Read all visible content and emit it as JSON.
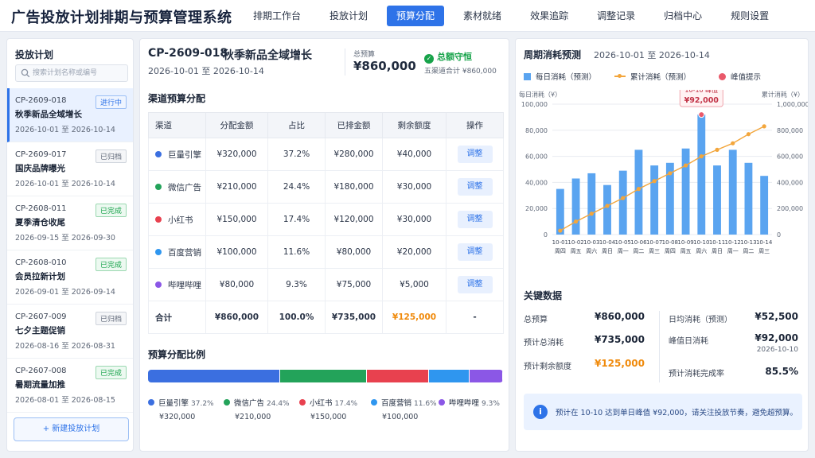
{
  "app": {
    "title": "广告投放计划排期与预算管理系统"
  },
  "nav": [
    {
      "label": "排期工作台",
      "active": false
    },
    {
      "label": "投放计划",
      "active": false
    },
    {
      "label": "预算分配",
      "active": true
    },
    {
      "label": "素材就绪",
      "active": false
    },
    {
      "label": "效果追踪",
      "active": false
    },
    {
      "label": "调整记录",
      "active": false
    },
    {
      "label": "归档中心",
      "active": false
    },
    {
      "label": "规则设置",
      "active": false
    }
  ],
  "sidebar": {
    "title": "投放计划",
    "search_placeholder": "搜索计划名称或编号",
    "new_button": "+ 新建投放计划",
    "plans": [
      {
        "code": "CP-2609-018",
        "name": "秋季新品全域增长",
        "dates": "2026-10-01 至 2026-10-14",
        "status": "进行中",
        "status_type": "run",
        "active": true
      },
      {
        "code": "CP-2609-017",
        "name": "国庆品牌曝光",
        "dates": "2026-10-01 至 2026-10-14",
        "status": "已归档",
        "status_type": "arch",
        "active": false
      },
      {
        "code": "CP-2608-011",
        "name": "夏季清仓收尾",
        "dates": "2026-09-15 至 2026-09-30",
        "status": "已完成",
        "status_type": "done",
        "active": false
      },
      {
        "code": "CP-2608-010",
        "name": "会员拉新计划",
        "dates": "2026-09-01 至 2026-09-14",
        "status": "已完成",
        "status_type": "done",
        "active": false
      },
      {
        "code": "CP-2607-009",
        "name": "七夕主题促销",
        "dates": "2026-08-16 至 2026-08-31",
        "status": "已归档",
        "status_type": "arch",
        "active": false
      },
      {
        "code": "CP-2607-008",
        "name": "暑期流量加推",
        "dates": "2026-08-01 至 2026-08-15",
        "status": "已完成",
        "status_type": "done",
        "active": false
      }
    ]
  },
  "plan": {
    "code": "CP-2609-018",
    "name": "秋季新品全域增长",
    "range": "2026-10-01 至 2026-10-14",
    "budget_label": "总预算",
    "budget_value": "¥860,000",
    "guard_label": "总额守恒",
    "guard_sub": "五渠道合计 ¥860,000"
  },
  "allocation": {
    "title": "渠道预算分配",
    "headers": [
      "渠道",
      "分配金额",
      "占比",
      "已排金额",
      "剩余额度",
      "操作"
    ],
    "adjust_label": "调整",
    "rows": [
      {
        "channel": "巨量引擎",
        "color": "#3b6fe0",
        "amount": "¥320,000",
        "ratio": "37.2%",
        "scheduled": "¥280,000",
        "remaining": "¥40,000"
      },
      {
        "channel": "微信广告",
        "color": "#23a35a",
        "amount": "¥210,000",
        "ratio": "24.4%",
        "scheduled": "¥180,000",
        "remaining": "¥30,000"
      },
      {
        "channel": "小红书",
        "color": "#e8414f",
        "amount": "¥150,000",
        "ratio": "17.4%",
        "scheduled": "¥120,000",
        "remaining": "¥30,000"
      },
      {
        "channel": "百度营销",
        "color": "#2f96ef",
        "amount": "¥100,000",
        "ratio": "11.6%",
        "scheduled": "¥80,000",
        "remaining": "¥20,000"
      },
      {
        "channel": "哔哩哔哩",
        "color": "#8b57e6",
        "amount": "¥80,000",
        "ratio": "9.3%",
        "scheduled": "¥75,000",
        "remaining": "¥5,000"
      }
    ],
    "total": {
      "label": "合计",
      "amount": "¥860,000",
      "ratio": "100.0%",
      "scheduled": "¥735,000",
      "remaining": "¥125,000",
      "op": "-"
    }
  },
  "ratio": {
    "title": "预算分配比例",
    "segments": [
      {
        "name": "巨量引擎",
        "pct": 37.2,
        "pct_label": "37.2%",
        "amount": "¥320,000",
        "color": "#3b6fe0"
      },
      {
        "name": "微信广告",
        "pct": 24.4,
        "pct_label": "24.4%",
        "amount": "¥210,000",
        "color": "#23a35a"
      },
      {
        "name": "小红书",
        "pct": 17.4,
        "pct_label": "17.4%",
        "amount": "¥150,000",
        "color": "#e8414f"
      },
      {
        "name": "百度营销",
        "pct": 11.6,
        "pct_label": "11.6%",
        "amount": "¥100,000",
        "color": "#2f96ef"
      },
      {
        "name": "哔哩哔哩",
        "pct": 9.3,
        "pct_label": "9.3%",
        "amount": "¥80,000",
        "color": "#8b57e6"
      }
    ]
  },
  "forecast": {
    "title": "周期消耗预测",
    "range": "2026-10-01 至 2026-10-14",
    "legend": [
      "每日消耗（预测）",
      "累计消耗（预测）",
      "峰值提示"
    ]
  },
  "chart_data": {
    "type": "bar",
    "title": "周期消耗预测",
    "ylabel": "每日消耗（¥）",
    "y2label": "累计消耗（¥）",
    "ylim": [
      0,
      100000
    ],
    "y2lim": [
      0,
      1000000
    ],
    "yticks": [
      "0",
      "20,000",
      "40,000",
      "60,000",
      "80,000",
      "100,000"
    ],
    "y2ticks": [
      "0",
      "200,000",
      "400,000",
      "600,000",
      "800,000",
      "1,000,000"
    ],
    "categories": [
      "10-01",
      "10-02",
      "10-03",
      "10-04",
      "10-05",
      "10-06",
      "10-07",
      "10-08",
      "10-09",
      "10-10",
      "10-11",
      "10-12",
      "10-13",
      "10-14"
    ],
    "weekdays": [
      "周四",
      "周五",
      "周六",
      "周日",
      "周一",
      "周二",
      "周三",
      "周四",
      "周五",
      "周六",
      "周日",
      "周一",
      "周二",
      "周三"
    ],
    "series": [
      {
        "name": "每日消耗（预测）",
        "type": "bar",
        "color": "#5aa4f0",
        "values": [
          35000,
          43000,
          47000,
          38000,
          49000,
          65000,
          53000,
          55000,
          66000,
          92000,
          53000,
          65000,
          55000,
          45000
        ]
      },
      {
        "name": "累计消耗（预测）",
        "type": "line",
        "color": "#f3a63c",
        "values": [
          30000,
          100000,
          160000,
          220000,
          280000,
          350000,
          410000,
          470000,
          530000,
          600000,
          650000,
          700000,
          770000,
          830000
        ]
      }
    ],
    "peak": {
      "index": 9,
      "label_line1": "10-10 峰值",
      "label_line2": "¥92,000",
      "color": "#e9596a"
    },
    "grid": true,
    "legend_position": "top"
  },
  "key_data": {
    "title": "关键数据",
    "left": [
      {
        "label": "总预算",
        "value": "¥860,000",
        "orange": false
      },
      {
        "label": "预计总消耗",
        "value": "¥735,000",
        "orange": false
      },
      {
        "label": "预计剩余额度",
        "value": "¥125,000",
        "orange": true
      }
    ],
    "right": [
      {
        "label": "日均消耗（预测）",
        "value": "¥52,500",
        "sub": ""
      },
      {
        "label": "峰值日消耗",
        "value": "¥92,000",
        "sub": "2026-10-10"
      },
      {
        "label": "预计消耗完成率",
        "value": "85.5%",
        "sub": ""
      }
    ],
    "notice": "预计在 10-10 达到单日峰值 ¥92,000，请关注投放节奏，避免超预算。"
  },
  "colors": {
    "accent": "#2e73e8",
    "success": "#17a34a",
    "warning": "#f08a0b"
  }
}
